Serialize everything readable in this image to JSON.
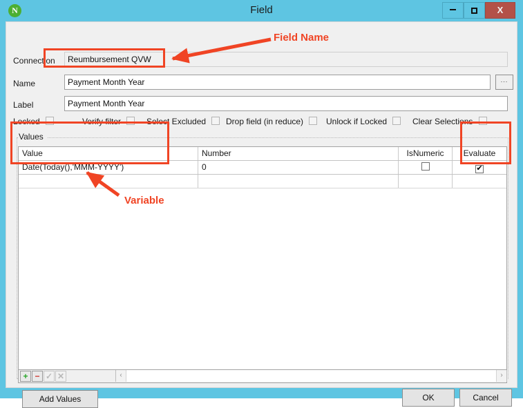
{
  "window": {
    "title": "Field",
    "logo_letter": "N",
    "logo_color": "#4caf32",
    "titlebar_color": "#5ec5e2",
    "close_color": "#b35148",
    "controls": {
      "minimize": "minimize-icon",
      "maximize": "maximize-icon",
      "close": "X"
    }
  },
  "form": {
    "connection": {
      "label": "Connection",
      "value": "Reumbursement QVW"
    },
    "name": {
      "label": "Name",
      "value": "Payment Month Year",
      "browse_button": "..."
    },
    "label_field": {
      "label": "Label",
      "value": "Payment Month Year"
    },
    "options": [
      {
        "label": "Locked",
        "checked": false,
        "enabled": false
      },
      {
        "label": "Verify filter",
        "checked": false,
        "enabled": false
      },
      {
        "label": "Select Excluded",
        "checked": false,
        "enabled": false
      },
      {
        "label": "Drop field (in reduce)",
        "checked": false,
        "enabled": false
      },
      {
        "label": "Unlock if Locked",
        "checked": false,
        "enabled": false
      },
      {
        "label": "Clear Selections",
        "checked": false,
        "enabled": false
      }
    ]
  },
  "values_group": {
    "caption": "Values",
    "columns": [
      "Value",
      "Number",
      "IsNumeric",
      "Evaluate"
    ],
    "rows": [
      {
        "value": "Date(Today(),'MMM-YYYY')",
        "number": "0",
        "isnumeric": false,
        "evaluate": true
      }
    ],
    "toolbar": {
      "add": "+",
      "delete": "−",
      "confirm": "✓",
      "cancel": "✕",
      "scroll_left": "‹",
      "scroll_right": "›"
    }
  },
  "buttons": {
    "add_values": "Add Values",
    "ok": "OK",
    "cancel": "Cancel"
  },
  "annotations": {
    "color": "#f04424",
    "field_name": "Field Name",
    "variable": "Variable"
  }
}
